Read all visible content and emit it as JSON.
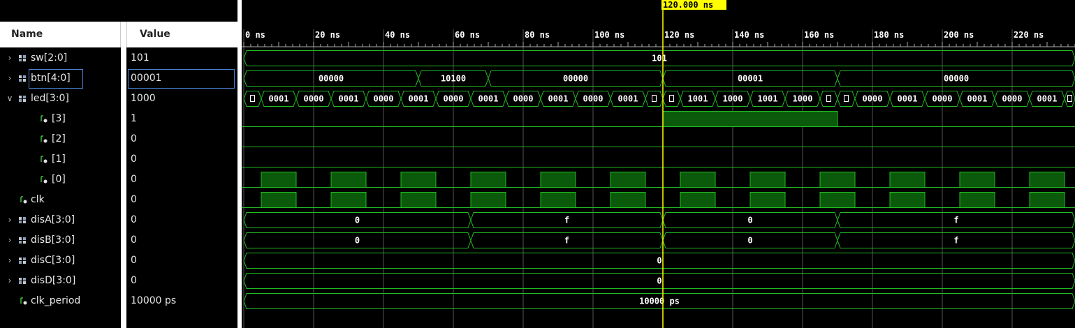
{
  "header": {
    "name_label": "Name",
    "value_label": "Value"
  },
  "signals": [
    {
      "name": "sw[2:0]",
      "value": "101",
      "kind": "bus",
      "expand": "collapsed"
    },
    {
      "name": "btn[4:0]",
      "value": "00001",
      "kind": "bus",
      "expand": "collapsed"
    },
    {
      "name": "led[3:0]",
      "value": "1000",
      "kind": "bus",
      "expand": "expanded"
    },
    {
      "name": "[3]",
      "value": "1",
      "kind": "bit",
      "child": true
    },
    {
      "name": "[2]",
      "value": "0",
      "kind": "bit",
      "child": true
    },
    {
      "name": "[1]",
      "value": "0",
      "kind": "bit",
      "child": true
    },
    {
      "name": "[0]",
      "value": "0",
      "kind": "bit",
      "child": true
    },
    {
      "name": "clk",
      "value": "0",
      "kind": "bit"
    },
    {
      "name": "disA[3:0]",
      "value": "0",
      "kind": "bus",
      "expand": "collapsed"
    },
    {
      "name": "disB[3:0]",
      "value": "0",
      "kind": "bus",
      "expand": "collapsed"
    },
    {
      "name": "disC[3:0]",
      "value": "0",
      "kind": "bus",
      "expand": "collapsed"
    },
    {
      "name": "disD[3:0]",
      "value": "0",
      "kind": "bus",
      "expand": "collapsed"
    },
    {
      "name": "clk_period",
      "value": "10000 ps",
      "kind": "bit"
    }
  ],
  "cursor": {
    "time_ns": 120,
    "label": "120.000 ns"
  },
  "timeline": {
    "ticks_ns": [
      0,
      20,
      40,
      60,
      80,
      100,
      120,
      140,
      160,
      180,
      200,
      220
    ],
    "tick_labels": [
      "0 ns",
      "20 ns",
      "40 ns",
      "60 ns",
      "80 ns",
      "100 ns",
      "120 ns",
      "140 ns",
      "160 ns",
      "180 ns",
      "200 ns",
      "220 ns"
    ]
  },
  "waves": {
    "sw": [
      {
        "start": 0,
        "end": 240,
        "label": "101"
      }
    ],
    "btn": [
      {
        "start": 0,
        "end": 50,
        "label": "00000"
      },
      {
        "start": 50,
        "end": 70,
        "label": "10100"
      },
      {
        "start": 70,
        "end": 120,
        "label": "00000"
      },
      {
        "start": 120,
        "end": 170,
        "label": "00001"
      },
      {
        "start": 170,
        "end": 240,
        "label": "00000"
      }
    ],
    "led": [
      {
        "start": 0,
        "end": 5,
        "label": ""
      },
      {
        "start": 5,
        "end": 15,
        "label": "0001"
      },
      {
        "start": 15,
        "end": 25,
        "label": "0000"
      },
      {
        "start": 25,
        "end": 35,
        "label": "0001"
      },
      {
        "start": 35,
        "end": 45,
        "label": "0000"
      },
      {
        "start": 45,
        "end": 55,
        "label": "0001"
      },
      {
        "start": 55,
        "end": 65,
        "label": "0000"
      },
      {
        "start": 65,
        "end": 75,
        "label": "0001"
      },
      {
        "start": 75,
        "end": 85,
        "label": "0000"
      },
      {
        "start": 85,
        "end": 95,
        "label": "0001"
      },
      {
        "start": 95,
        "end": 105,
        "label": "0000"
      },
      {
        "start": 105,
        "end": 115,
        "label": "0001"
      },
      {
        "start": 115,
        "end": 120,
        "label": ""
      },
      {
        "start": 120,
        "end": 125,
        "label": ""
      },
      {
        "start": 125,
        "end": 135,
        "label": "1001"
      },
      {
        "start": 135,
        "end": 145,
        "label": "1000"
      },
      {
        "start": 145,
        "end": 155,
        "label": "1001"
      },
      {
        "start": 155,
        "end": 165,
        "label": "1000"
      },
      {
        "start": 165,
        "end": 170,
        "label": ""
      },
      {
        "start": 170,
        "end": 175,
        "label": ""
      },
      {
        "start": 175,
        "end": 185,
        "label": "0000"
      },
      {
        "start": 185,
        "end": 195,
        "label": "0001"
      },
      {
        "start": 195,
        "end": 205,
        "label": "0000"
      },
      {
        "start": 205,
        "end": 215,
        "label": "0001"
      },
      {
        "start": 215,
        "end": 225,
        "label": "0000"
      },
      {
        "start": 225,
        "end": 235,
        "label": "0001"
      },
      {
        "start": 235,
        "end": 240,
        "label": ""
      }
    ],
    "led3_high": [
      [
        120,
        170
      ]
    ],
    "led0_high": [
      [
        5,
        15
      ],
      [
        25,
        35
      ],
      [
        45,
        55
      ],
      [
        65,
        75
      ],
      [
        85,
        95
      ],
      [
        105,
        115
      ],
      [
        125,
        135
      ],
      [
        145,
        155
      ],
      [
        165,
        175
      ],
      [
        185,
        195
      ],
      [
        205,
        215
      ],
      [
        225,
        235
      ]
    ],
    "clk_high": [
      [
        5,
        15
      ],
      [
        25,
        35
      ],
      [
        45,
        55
      ],
      [
        65,
        75
      ],
      [
        85,
        95
      ],
      [
        105,
        115
      ],
      [
        125,
        135
      ],
      [
        145,
        155
      ],
      [
        165,
        175
      ],
      [
        185,
        195
      ],
      [
        205,
        215
      ],
      [
        225,
        235
      ]
    ],
    "disA": [
      {
        "start": 0,
        "end": 65,
        "label": "0"
      },
      {
        "start": 65,
        "end": 120,
        "label": "f"
      },
      {
        "start": 120,
        "end": 170,
        "label": "0"
      },
      {
        "start": 170,
        "end": 240,
        "label": "f"
      }
    ],
    "disB": [
      {
        "start": 0,
        "end": 65,
        "label": "0"
      },
      {
        "start": 65,
        "end": 120,
        "label": "f"
      },
      {
        "start": 120,
        "end": 170,
        "label": "0"
      },
      {
        "start": 170,
        "end": 240,
        "label": "f"
      }
    ],
    "disC": [
      {
        "start": 0,
        "end": 240,
        "label": "0"
      }
    ],
    "disD": [
      {
        "start": 0,
        "end": 240,
        "label": "0"
      }
    ],
    "clk_period": [
      {
        "start": 0,
        "end": 240,
        "label": "10000 ps"
      }
    ]
  },
  "colors": {
    "wave": "#22bb22",
    "fill": "#0b5a0b",
    "grid": "#555555",
    "cursor": "#ffff00",
    "text": "#ffffff"
  }
}
